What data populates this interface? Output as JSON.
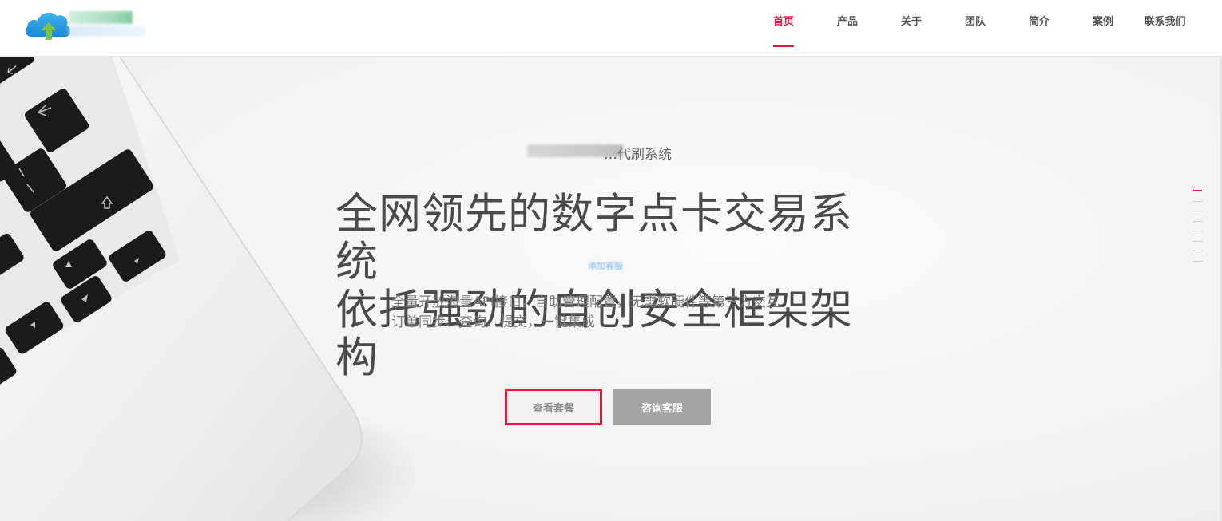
{
  "header": {
    "logo_icon": "cloud-upload-icon",
    "nav": [
      {
        "label": "首页",
        "active": true
      },
      {
        "label": "产品",
        "active": false
      },
      {
        "label": "关于",
        "active": false
      },
      {
        "label": "团队",
        "active": false
      },
      {
        "label": "简介",
        "active": false
      },
      {
        "label": "案例",
        "active": false
      },
      {
        "label": "联系我们",
        "active": false
      }
    ]
  },
  "hero": {
    "subtitle": "…代刷系统",
    "headline_line1": "全网领先的数字点卡交易系统",
    "headline_line2": "依托强劲的自创安全框架架构",
    "overlay_text": "添加客服",
    "desc_line1": "全量开放海量API接口，自助管理配置，无需软硬件等第三方交互",
    "desc_line2": "订单同步、查询、提交，一键集成",
    "primary_button": "查看套餐",
    "secondary_button": "咨询客服"
  },
  "side_nav": {
    "count": 8,
    "active_index": 0
  },
  "colors": {
    "accent": "#e5173f",
    "nav_text": "#555555",
    "headline": "#4a4a4a",
    "button_gray": "#a3a3a3"
  }
}
